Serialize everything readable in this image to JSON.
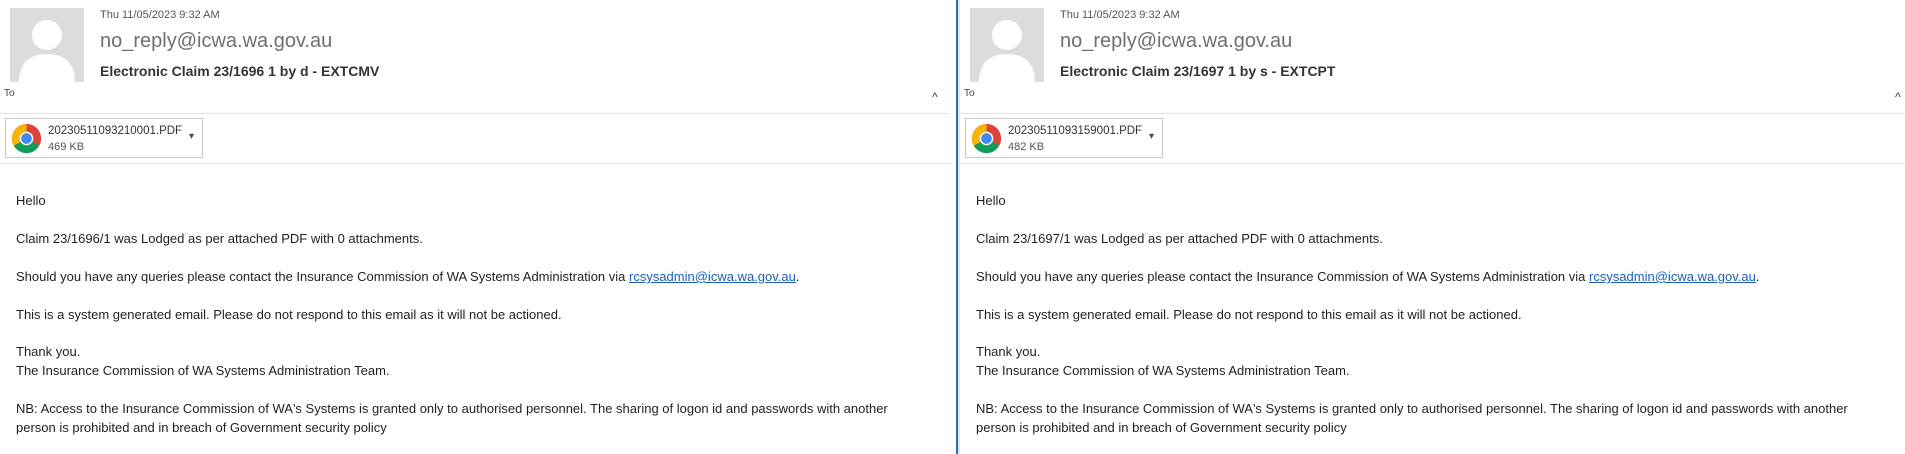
{
  "emails": [
    {
      "date": "Thu 11/05/2023 9:32 AM",
      "from": "no_reply@icwa.wa.gov.au",
      "subject": "Electronic Claim 23/1696 1 by  d - EXTCMV",
      "to_label": "To",
      "collapse_icon": "^",
      "attachment": {
        "name": "20230511093210001.PDF",
        "size": "469 KB",
        "caret": "▾"
      },
      "body": {
        "greeting": "Hello",
        "claim_line": "Claim 23/1696/1 was Lodged as per attached PDF with 0 attachments.",
        "query_prefix": "Should you have any queries please contact the Insurance Commission of WA Systems Administration via ",
        "query_link": "rcsysadmin@icwa.wa.gov.au",
        "query_suffix": ".",
        "system_note": "This is a system generated email. Please do not respond to this email as it will not be actioned.",
        "thanks": "Thank you.",
        "team": "The Insurance Commission of WA Systems Administration Team.",
        "nb_line1": "NB: Access to the Insurance Commission of WA's Systems is granted only to authorised personnel. The sharing of logon id and passwords with another",
        "nb_line2": "person is prohibited and in breach of Government security policy"
      }
    },
    {
      "date": "Thu 11/05/2023 9:32 AM",
      "from": "no_reply@icwa.wa.gov.au",
      "subject": "Electronic Claim 23/1697 1 by  s - EXTCPT",
      "to_label": "To",
      "collapse_icon": "^",
      "attachment": {
        "name": "20230511093159001.PDF",
        "size": "482 KB",
        "caret": "▾"
      },
      "body": {
        "greeting": "Hello",
        "claim_line": "Claim 23/1697/1 was Lodged as per attached PDF with 0 attachments.",
        "query_prefix": "Should you have any queries please contact the Insurance Commission of WA Systems Administration via ",
        "query_link": "rcsysadmin@icwa.wa.gov.au",
        "query_suffix": ".",
        "system_note": "This is a system generated email. Please do not respond to this email as it will not be actioned.",
        "thanks": "Thank you.",
        "team": "The Insurance Commission of WA Systems Administration Team.",
        "nb_line1": "NB: Access to the Insurance Commission of WA's Systems is granted only to authorised personnel. The sharing of logon id and passwords with another",
        "nb_line2": "person is prohibited and in breach of Government security policy"
      }
    }
  ],
  "icons": {
    "avatar": "person-placeholder-icon",
    "attachment": "chrome-icon"
  },
  "colors": {
    "link": "#1a5fb4",
    "divider": "#2b6cb0"
  }
}
